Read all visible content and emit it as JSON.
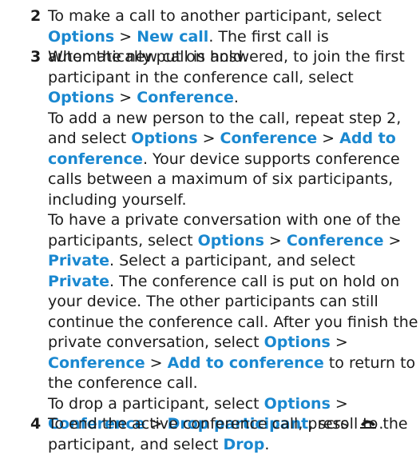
{
  "steps": [
    {
      "number": "2",
      "paragraphs": [
        [
          {
            "t": "To make a call to another participant, select "
          },
          {
            "t": "Options",
            "h": true
          },
          {
            "t": " > "
          },
          {
            "t": "New call",
            "h": true
          },
          {
            "t": ". The first call is automatically put on hold."
          }
        ]
      ]
    },
    {
      "number": "3",
      "paragraphs": [
        [
          {
            "t": "When the new call is answered, to join the first participant in the conference call, select "
          },
          {
            "t": "Options",
            "h": true
          },
          {
            "t": " > "
          },
          {
            "t": "Conference",
            "h": true
          },
          {
            "t": "."
          }
        ],
        [
          {
            "t": "To add a new person to the call, repeat step 2, and select "
          },
          {
            "t": "Options",
            "h": true
          },
          {
            "t": " > "
          },
          {
            "t": "Conference",
            "h": true
          },
          {
            "t": " > "
          },
          {
            "t": "Add to conference",
            "h": true
          },
          {
            "t": ". Your device supports conference calls between a maximum of six participants, including yourself."
          }
        ],
        [
          {
            "t": "To have a private conversation with one of the participants, select "
          },
          {
            "t": "Options",
            "h": true
          },
          {
            "t": " > "
          },
          {
            "t": "Conference",
            "h": true
          },
          {
            "t": " > "
          },
          {
            "t": "Private",
            "h": true
          },
          {
            "t": ". Select a participant, and select "
          },
          {
            "t": "Private",
            "h": true
          },
          {
            "t": ". The conference call is put on hold on your device. The other participants can still continue the conference call. After you finish the private conversation, select "
          },
          {
            "t": "Options",
            "h": true
          },
          {
            "t": " > "
          },
          {
            "t": "Conference",
            "h": true
          },
          {
            "t": " > "
          },
          {
            "t": "Add to conference",
            "h": true
          },
          {
            "t": " to return to the conference call."
          }
        ],
        [
          {
            "t": "To drop a participant, select "
          },
          {
            "t": "Options",
            "h": true
          },
          {
            "t": " > "
          },
          {
            "t": "Conference",
            "h": true
          },
          {
            "t": " > "
          },
          {
            "t": "Drop participant",
            "h": true
          },
          {
            "t": ", scroll to the participant, and select "
          },
          {
            "t": "Drop",
            "h": true
          },
          {
            "t": "."
          }
        ]
      ]
    },
    {
      "number": "4",
      "paragraphs": [
        [
          {
            "t": "To end the active conference call, press "
          },
          {
            "t": ".",
            "icon": "end-call-key-icon"
          }
        ]
      ]
    }
  ],
  "colors": {
    "highlight": "#1a88d0",
    "text": "#1b1b1b"
  }
}
